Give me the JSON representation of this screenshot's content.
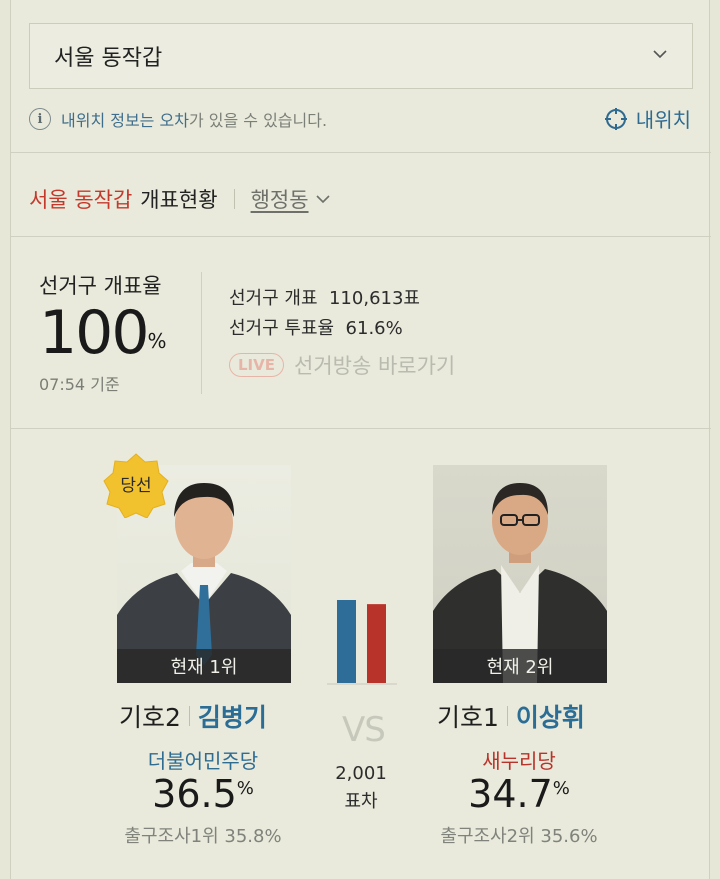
{
  "region_select": {
    "value": "서울 동작갑",
    "icon": "chevron-down-icon"
  },
  "notice": {
    "part1": "내위치 정보는 오차",
    "part2": "가 있을 수 있습니다.",
    "icon": "info-icon"
  },
  "my_location": {
    "label": "내위치",
    "icon": "crosshair-icon"
  },
  "count_header": {
    "district": "서울 동작갑",
    "title": "개표현황",
    "dong_label": "행정동"
  },
  "rate": {
    "label": "선거구 개표율",
    "value": "100",
    "unit": "%",
    "time": "07:54 기준"
  },
  "stats": [
    {
      "label": "선거구 개표",
      "value": "110,613표"
    },
    {
      "label": "선거구 투표율",
      "value": "61.6%"
    }
  ],
  "live": {
    "badge": "LIVE",
    "label": "선거방송 바로가기"
  },
  "vs_label": "VS",
  "margin": {
    "value": "2,001",
    "label": "표차"
  },
  "vote_share": {
    "left": 36.5,
    "right": 34.7
  },
  "candidates": [
    {
      "rank_label": "현재 1위",
      "number": "기호2",
      "name": "김병기",
      "party": "더불어민주당",
      "party_color": "#2e6c92",
      "pct": "36.5",
      "exit_poll": "출구조사1위 35.8%",
      "badge": "당선"
    },
    {
      "rank_label": "현재 2위",
      "number": "기호1",
      "name": "이상휘",
      "party": "새누리당",
      "party_color": "#b8332a",
      "pct": "34.7",
      "exit_poll": "출구조사2위 35.6%"
    }
  ],
  "colors": {
    "accent_blue": "#2c6d95",
    "accent_red": "#c33a2d",
    "bar_blue": "#2d6d97",
    "bar_red": "#b8332a"
  }
}
